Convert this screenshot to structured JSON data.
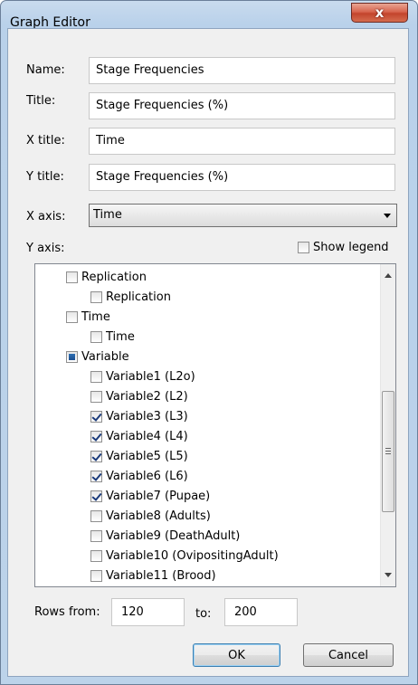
{
  "window": {
    "title": "Graph Editor",
    "close_glyph": "x"
  },
  "form": {
    "name_label": "Name:",
    "name_value": "Stage Frequencies",
    "title_label": "Title:",
    "title_value": "Stage Frequencies (%)",
    "xtitle_label": "X title:",
    "xtitle_value": "Time",
    "ytitle_label": "Y title:",
    "ytitle_value": "Stage Frequencies (%)",
    "xaxis_label": "X axis:",
    "xaxis_value": "Time",
    "yaxis_label": "Y axis:",
    "show_legend_label": "Show legend",
    "show_legend_checked": false
  },
  "tree": {
    "items": [
      {
        "label": "Replication",
        "level": 0,
        "state": "unchecked"
      },
      {
        "label": "Replication",
        "level": 1,
        "state": "unchecked"
      },
      {
        "label": "Time",
        "level": 0,
        "state": "unchecked"
      },
      {
        "label": "Time",
        "level": 1,
        "state": "unchecked"
      },
      {
        "label": "Variable",
        "level": 0,
        "state": "partial"
      },
      {
        "label": "Variable1 (L2o)",
        "level": 1,
        "state": "unchecked"
      },
      {
        "label": "Variable2 (L2)",
        "level": 1,
        "state": "unchecked"
      },
      {
        "label": "Variable3 (L3)",
        "level": 1,
        "state": "checked"
      },
      {
        "label": "Variable4 (L4)",
        "level": 1,
        "state": "checked"
      },
      {
        "label": "Variable5 (L5)",
        "level": 1,
        "state": "checked"
      },
      {
        "label": "Variable6 (L6)",
        "level": 1,
        "state": "checked"
      },
      {
        "label": "Variable7 (Pupae)",
        "level": 1,
        "state": "checked"
      },
      {
        "label": "Variable8 (Adults)",
        "level": 1,
        "state": "unchecked"
      },
      {
        "label": "Variable9 (DeathAdult)",
        "level": 1,
        "state": "unchecked"
      },
      {
        "label": "Variable10 (OvipositingAdult)",
        "level": 1,
        "state": "unchecked"
      },
      {
        "label": "Variable11 (Brood)",
        "level": 1,
        "state": "unchecked"
      }
    ]
  },
  "rows": {
    "from_label": "Rows from:",
    "from_value": "120",
    "to_label": "to:",
    "to_value": "200"
  },
  "buttons": {
    "ok": "OK",
    "cancel": "Cancel"
  }
}
